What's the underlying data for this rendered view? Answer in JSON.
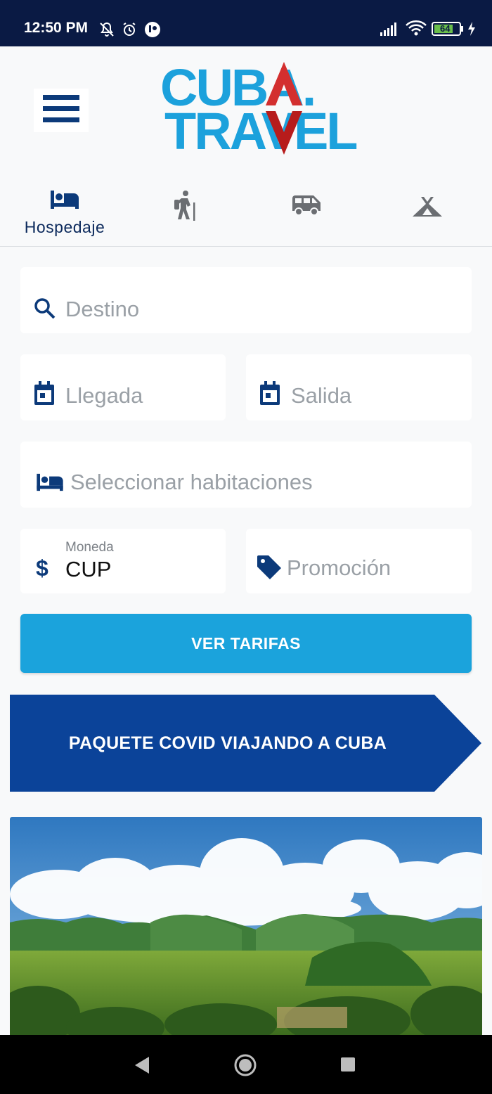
{
  "status_bar": {
    "time": "12:50 PM",
    "battery": "64",
    "icons": [
      "mute-icon",
      "alarm-icon",
      "app-icon",
      "signal-icon",
      "wifi-icon",
      "battery-icon",
      "charging-icon"
    ]
  },
  "header": {
    "menu_icon": "hamburger-icon",
    "logo_line1": "CUBA.",
    "logo_line2": "TRAVEL"
  },
  "tabs": [
    {
      "icon": "bed-icon",
      "label": "Hospedaje",
      "active": true
    },
    {
      "icon": "hiker-icon",
      "label": "",
      "active": false
    },
    {
      "icon": "van-icon",
      "label": "",
      "active": false
    },
    {
      "icon": "tent-icon",
      "label": "",
      "active": false
    }
  ],
  "form": {
    "destination_placeholder": "Destino",
    "arrival_placeholder": "Llegada",
    "departure_placeholder": "Salida",
    "rooms_placeholder": "Seleccionar habitaciones",
    "currency_label": "Moneda",
    "currency_value": "CUP",
    "promo_placeholder": "Promoción",
    "submit_label": "VER TARIFAS"
  },
  "banner": {
    "text": "PAQUETE COVID VIAJANDO A CUBA"
  },
  "colors": {
    "accent": "#1ba3dc",
    "brand_dark": "#0c3a7a",
    "banner": "#0b4399",
    "status_bar": "#0a1a44",
    "logo_red": "#d32f2f"
  }
}
